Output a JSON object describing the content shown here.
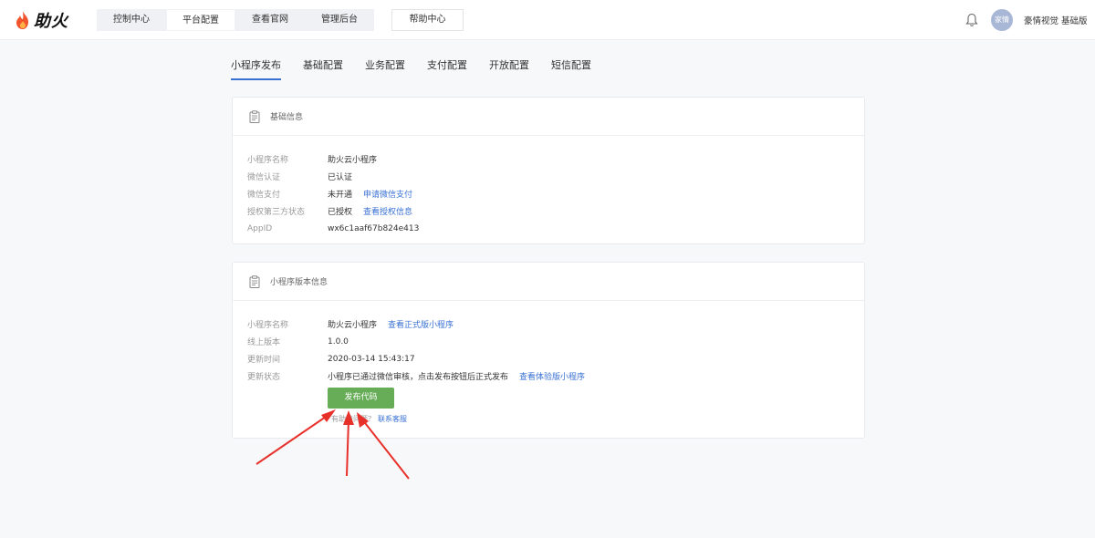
{
  "app": {
    "logo_text": "助火"
  },
  "nav": {
    "items": [
      "控制中心",
      "平台配置",
      "查看官网",
      "管理后台"
    ],
    "active_index": 1,
    "help": "帮助中心"
  },
  "user": {
    "avatar_text": "家情",
    "name": "豪情视觉 基础版"
  },
  "subtabs": {
    "items": [
      "小程序发布",
      "基础配置",
      "业务配置",
      "支付配置",
      "开放配置",
      "短信配置"
    ],
    "active_index": 0
  },
  "basic_info": {
    "title": "基础信息",
    "rows": [
      {
        "label": "小程序名称",
        "value": "助火云小程序",
        "link": ""
      },
      {
        "label": "微信认证",
        "value": "已认证",
        "link": ""
      },
      {
        "label": "微信支付",
        "value": "未开通",
        "link": "申请微信支付"
      },
      {
        "label": "授权第三方状态",
        "value": "已授权",
        "link": "查看授权信息"
      },
      {
        "label": "AppID",
        "value": "wx6c1aaf67b824e413",
        "link": ""
      }
    ]
  },
  "version_info": {
    "title": "小程序版本信息",
    "rows": [
      {
        "label": "小程序名称",
        "value": "助火云小程序",
        "link": "查看正式版小程序"
      },
      {
        "label": "线上版本",
        "value": "1.0.0",
        "link": ""
      },
      {
        "label": "更新时间",
        "value": "2020-03-14 15:43:17",
        "link": ""
      },
      {
        "label": "更新状态",
        "value": "小程序已通过微信审核，点击发布按钮后正式发布",
        "link": "查看体验版小程序"
      }
    ],
    "publish_button": "发布代码",
    "help_text": "有助请问题？",
    "help_link": "联系客服"
  },
  "colors": {
    "accent": "#3a72d4",
    "publish_button": "#67ac57",
    "annotation_arrow": "#e8302a"
  }
}
